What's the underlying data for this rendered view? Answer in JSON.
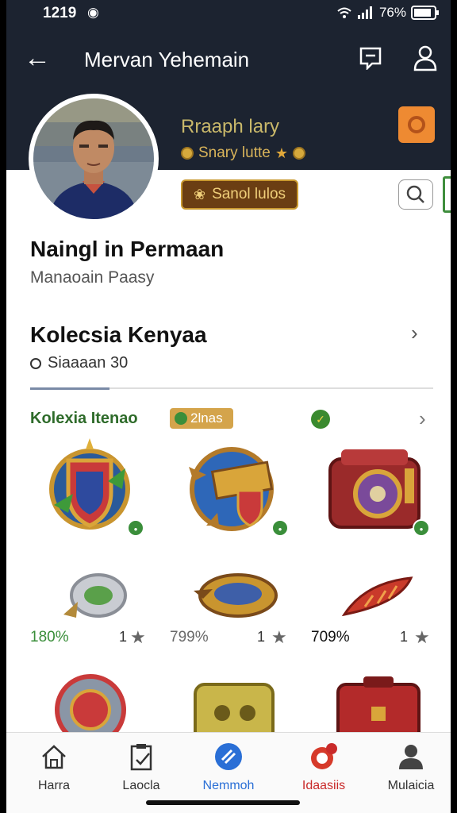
{
  "status_bar": {
    "time": "1219",
    "battery": "76%"
  },
  "app_bar": {
    "title": "Mervan Yehemain"
  },
  "profile": {
    "name": "Rraaph lary",
    "subtitle": "Snary lutte",
    "gold_button_label": "Sanol lulos"
  },
  "sections": {
    "section1_title": "Naingl in Permaan",
    "section1_sub": "Manaoain Paasy",
    "section2_title": "Kolecsia Kenyaa",
    "section2_sub": "Siaaaan 30"
  },
  "collection": {
    "title": "Kolexia Itenao",
    "badge_label": "2lnas",
    "items_row2": [
      {
        "percent": "180%",
        "count": "1",
        "percent_color": "#3a8e3a"
      },
      {
        "percent": "799%",
        "count": "1",
        "percent_color": "#6a6a6a"
      },
      {
        "percent": "709%",
        "count": "1",
        "percent_color": "#111111"
      }
    ]
  },
  "bottom_nav": [
    {
      "label": "Harra",
      "color": "#333333"
    },
    {
      "label": "Laocla",
      "color": "#333333"
    },
    {
      "label": "Nemmoh",
      "color": "#2a6fd6"
    },
    {
      "label": "Idaasiis",
      "color": "#c92a2a"
    },
    {
      "label": "Mulaicia",
      "color": "#333333"
    }
  ],
  "colors": {
    "header_bg": "#1c2330",
    "accent_blue": "#2a6fd6",
    "accent_green": "#3a8e3a",
    "accent_red": "#c92a2a",
    "gold": "#d4a44b"
  }
}
